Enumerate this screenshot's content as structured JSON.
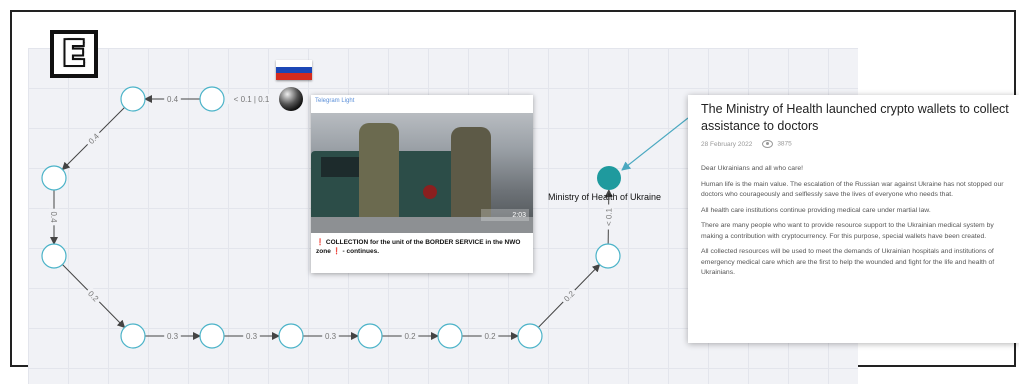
{
  "logo": {
    "letter": "E"
  },
  "flag": {
    "colors": [
      "#ffffff",
      "#1c47b6",
      "#d52b1e"
    ]
  },
  "graph": {
    "nodes": [
      {
        "id": "n1",
        "label": ""
      },
      {
        "id": "n2",
        "label": ""
      },
      {
        "id": "n3",
        "label": ""
      },
      {
        "id": "n4",
        "label": ""
      },
      {
        "id": "n5",
        "label": ""
      },
      {
        "id": "n6",
        "label": ""
      },
      {
        "id": "n7",
        "label": ""
      },
      {
        "id": "n8",
        "label": ""
      },
      {
        "id": "n9",
        "label": ""
      },
      {
        "id": "n10",
        "label": ""
      },
      {
        "id": "n11",
        "label": ""
      },
      {
        "id": "n12",
        "label": ""
      },
      {
        "id": "source",
        "label": ""
      },
      {
        "id": "ministry",
        "label": "Ministry of Health of Ukraine"
      }
    ],
    "edges": [
      {
        "from": "source",
        "to": "n2",
        "label": "< 0.1  |  0.1"
      },
      {
        "from": "n2",
        "to": "n1",
        "label": "0.4"
      },
      {
        "from": "n1",
        "to": "n3",
        "label": "0.4"
      },
      {
        "from": "n3",
        "to": "n4",
        "label": "0.4"
      },
      {
        "from": "n4",
        "to": "n5",
        "label": "0.2"
      },
      {
        "from": "n5",
        "to": "n6",
        "label": "0.3"
      },
      {
        "from": "n6",
        "to": "n7",
        "label": "0.3"
      },
      {
        "from": "n7",
        "to": "n8",
        "label": "0.3"
      },
      {
        "from": "n8",
        "to": "n9",
        "label": "0.2"
      },
      {
        "from": "n9",
        "to": "n10",
        "label": "0.2"
      },
      {
        "from": "n10",
        "to": "n11",
        "label": "0.2"
      },
      {
        "from": "n11",
        "to": "n12",
        "label": "0.2"
      },
      {
        "from": "n12",
        "to": "ministry",
        "label": "< 0.1"
      }
    ],
    "colors": {
      "node_fill": "#ffffff",
      "node_stroke": "#4bb3c8",
      "ministry": "#1f9a9e",
      "source": "#333333",
      "edge": "#444444",
      "pointer": "#4aa8c0"
    }
  },
  "news_card": {
    "source": "Telegram Light",
    "stamp": "2:03",
    "caption_prefix": "❗",
    "caption": "COLLECTION for the unit of the BORDER SERVICE in the NWO zone",
    "caption_mid": "❗",
    "caption_suffix": "- continues."
  },
  "article": {
    "title": "The Ministry of Health launched crypto wallets to collect assistance to doctors",
    "date": "28 February 2022",
    "views": "3875",
    "paragraphs": [
      "Dear Ukrainians and all who care!",
      "Human life is the main value. The escalation of the Russian war against Ukraine has not stopped our doctors who courageously and selflessly save the lives of everyone who needs that.",
      "All health care institutions continue providing medical care under martial law.",
      "There are many people who want to provide resource support to the Ukrainian medical system by making a contribution with cryptocurrency. For this purpose, special wallets have been created.",
      "All collected resources will be used to meet the demands of Ukrainian hospitals and institutions of emergency medical care which are the first to help the wounded and fight for the life and health of Ukrainians."
    ]
  }
}
